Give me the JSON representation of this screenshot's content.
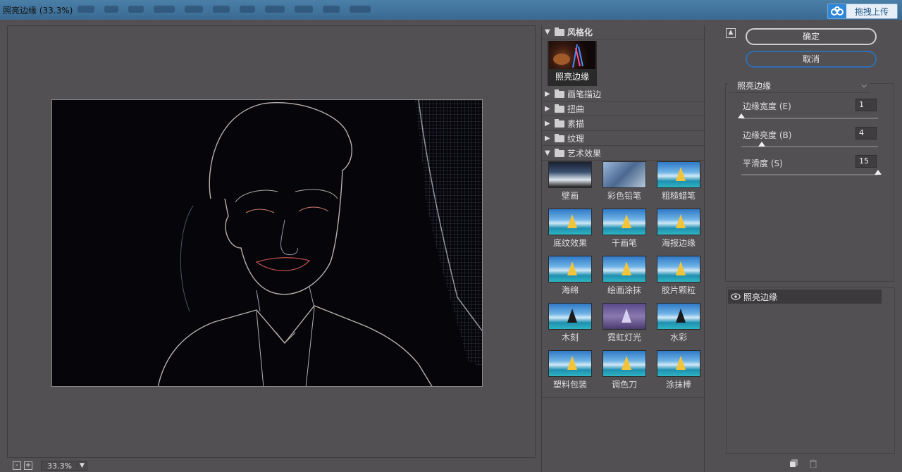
{
  "window": {
    "title": "照亮边缘 (33.3%)",
    "upload_button": "拖拽上传"
  },
  "preview": {
    "zoom": "33.3%",
    "zoom_out": "-",
    "zoom_in": "+"
  },
  "gallery": {
    "categories": [
      {
        "label": "风格化",
        "expanded": true
      },
      {
        "label": "画笔描边",
        "expanded": false
      },
      {
        "label": "扭曲",
        "expanded": false
      },
      {
        "label": "素描",
        "expanded": false
      },
      {
        "label": "纹理",
        "expanded": false
      },
      {
        "label": "艺术效果",
        "expanded": true
      }
    ],
    "stylize_items": [
      "照亮边缘"
    ],
    "artistic_items": [
      "壁画",
      "彩色铅笔",
      "粗糙蜡笔",
      "底纹效果",
      "干画笔",
      "海报边缘",
      "海绵",
      "绘画涂抹",
      "胶片颗粒",
      "木刻",
      "霓虹灯光",
      "水彩",
      "塑料包装",
      "调色刀",
      "涂抹棒"
    ]
  },
  "actions": {
    "ok": "确定",
    "cancel": "取消"
  },
  "settings": {
    "filter": "照亮边缘",
    "params": [
      {
        "label": "边缘宽度 (E)",
        "value": "1",
        "level": 0.0
      },
      {
        "label": "边缘亮度 (B)",
        "value": "4",
        "level": 0.15
      },
      {
        "label": "平滑度 (S)",
        "value": "15",
        "level": 1.0
      }
    ]
  },
  "layers": {
    "items": [
      "照亮边缘"
    ]
  }
}
